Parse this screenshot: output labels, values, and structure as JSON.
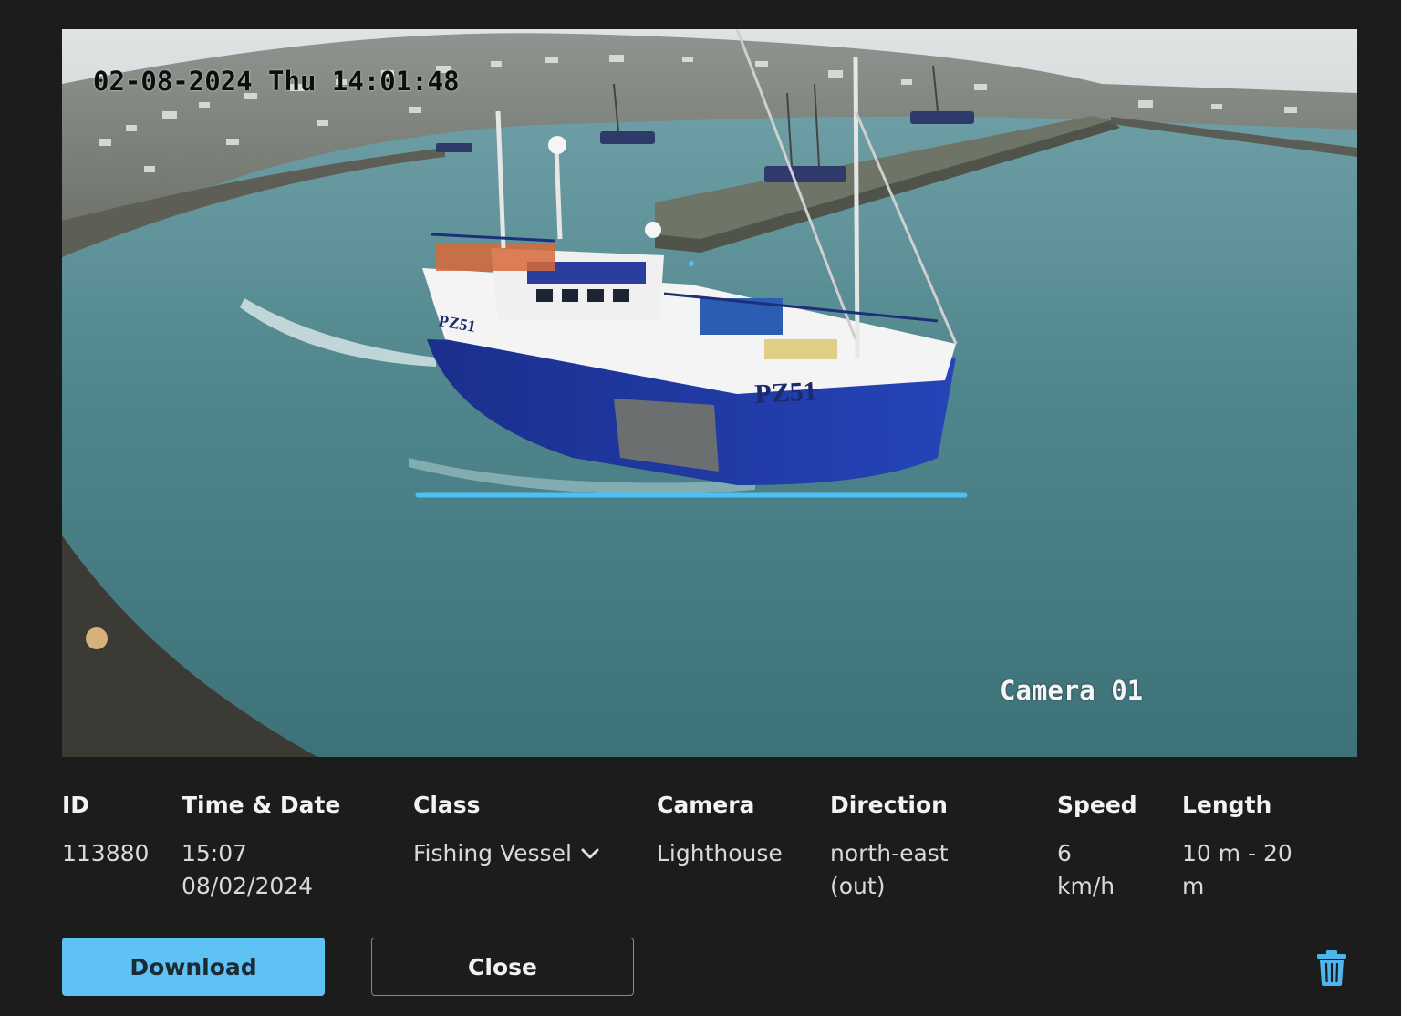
{
  "image": {
    "timestamp_overlay": "02-08-2024 Thu 14:01:48",
    "camera_overlay": "Camera 01",
    "hull_marking": "PZ51"
  },
  "details": {
    "columns": [
      {
        "header": "ID",
        "value_lines": [
          "113880"
        ]
      },
      {
        "header": "Time & Date",
        "value_lines": [
          "15:07",
          "08/02/2024"
        ]
      },
      {
        "header": "Class",
        "value_lines": [
          "Fishing Vessel"
        ]
      },
      {
        "header": "Camera",
        "value_lines": [
          "Lighthouse"
        ]
      },
      {
        "header": "Direction",
        "value_lines": [
          "north-east",
          "(out)"
        ]
      },
      {
        "header": "Speed",
        "value_lines": [
          "6",
          "km/h"
        ]
      },
      {
        "header": "Length",
        "value_lines": [
          "10 m - 20",
          "m"
        ]
      }
    ]
  },
  "actions": {
    "download_label": "Download",
    "close_label": "Close",
    "delete_icon": "trash-icon"
  },
  "colors": {
    "background": "#1c1c1c",
    "accent": "#5fc2f4",
    "detection_line": "#4fc0f2"
  }
}
